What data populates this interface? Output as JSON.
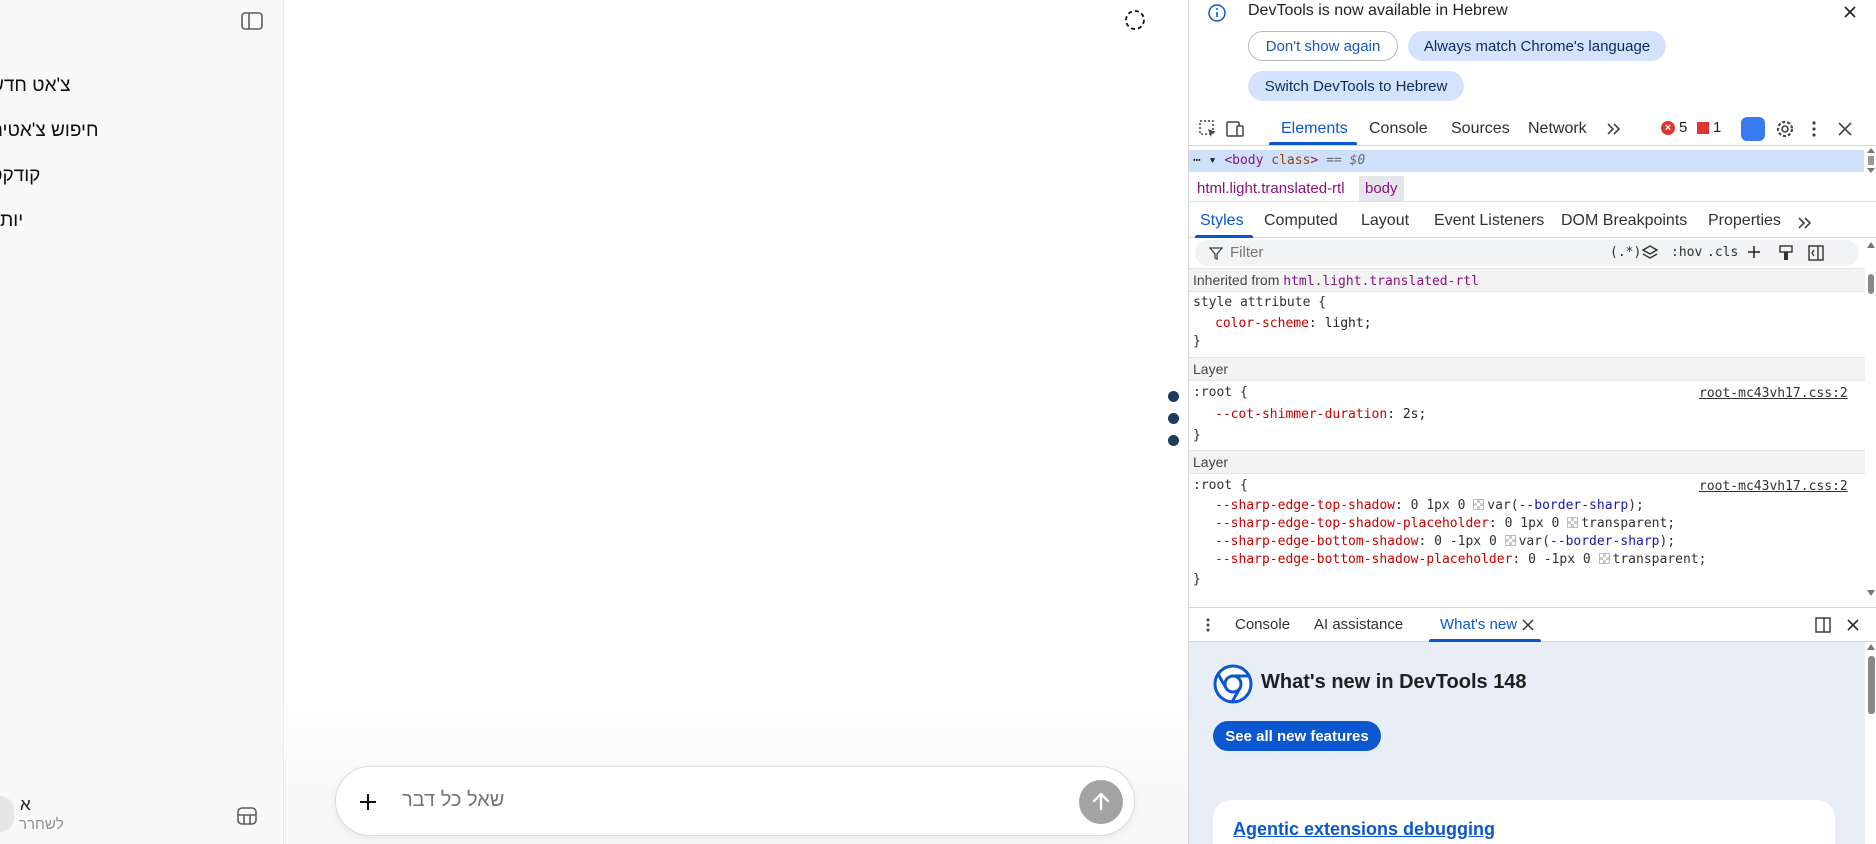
{
  "app": {
    "nav": [
      {
        "label": "צ'אט חדש",
        "icon": "edit-icon"
      },
      {
        "label": "חיפוש צ'אטים",
        "icon": "search-icon"
      },
      {
        "label": "קודקס",
        "icon": "codex-icon"
      },
      {
        "label": "יותר",
        "icon": "more-icon"
      }
    ],
    "user": {
      "initial": "א",
      "plan": "לשחרר"
    },
    "composer": {
      "placeholder": "שאל כל דבר"
    }
  },
  "devtools": {
    "banner": {
      "message": "DevTools is now available in Hebrew",
      "dont_show": "Don't show again",
      "always_match": "Always match Chrome's language",
      "switch": "Switch DevTools to Hebrew"
    },
    "tabs": [
      "Elements",
      "Console",
      "Sources",
      "Network"
    ],
    "active_tab": "Elements",
    "errors": "5",
    "issues": "1",
    "dom_line": {
      "tag_open": "<body",
      "attr": " class",
      "rest": ">",
      "eq": " == $0"
    },
    "breadcrumbs": [
      "html.light.translated-rtl",
      "body"
    ],
    "subtabs": [
      "Styles",
      "Computed",
      "Layout",
      "Event Listeners",
      "DOM Breakpoints",
      "Properties"
    ],
    "filter": {
      "placeholder": "Filter",
      "regex": "(.*)",
      "hov": ":hov",
      "cls": ".cls"
    },
    "styles": {
      "inherited_label": "Inherited from ",
      "inherited_from": "html.light.translated-rtl",
      "style_attr_selector": "style attribute {",
      "style_attr_prop": "color-scheme",
      "style_attr_val": "light;",
      "close_brace": "}",
      "layer_label": "Layer",
      "rule1": {
        "selector": ":root {",
        "source": "root-mc43vh17.css:2",
        "decls": [
          {
            "prop": "--cot-shimmer-duration",
            "val": "2s;"
          }
        ]
      },
      "rule2": {
        "selector": ":root {",
        "source": "root-mc43vh17.css:2",
        "decls": [
          {
            "prop": "--sharp-edge-top-shadow",
            "pre": "0 1px 0 ",
            "var": "--border-sharp",
            "post": ");"
          },
          {
            "prop": "--sharp-edge-top-shadow-placeholder",
            "pre": "0 1px 0 ",
            "val": "transparent;"
          },
          {
            "prop": "--sharp-edge-bottom-shadow",
            "pre": "0 -1px 0 ",
            "var": "--border-sharp",
            "post": ");"
          },
          {
            "prop": "--sharp-edge-bottom-shadow-placeholder",
            "pre": "0 -1px 0 ",
            "val": "transparent;"
          }
        ]
      }
    },
    "drawer": {
      "tabs": [
        "Console",
        "AI assistance",
        "What's new"
      ],
      "active": "What's new",
      "whats_new_title": "What's new in DevTools 148",
      "see_all": "See all new features",
      "card_link": "Agentic extensions debugging"
    },
    "colors": {
      "accent": "#0b57d0",
      "selected_row": "#cfe0fb",
      "error": "#dc362e"
    }
  }
}
